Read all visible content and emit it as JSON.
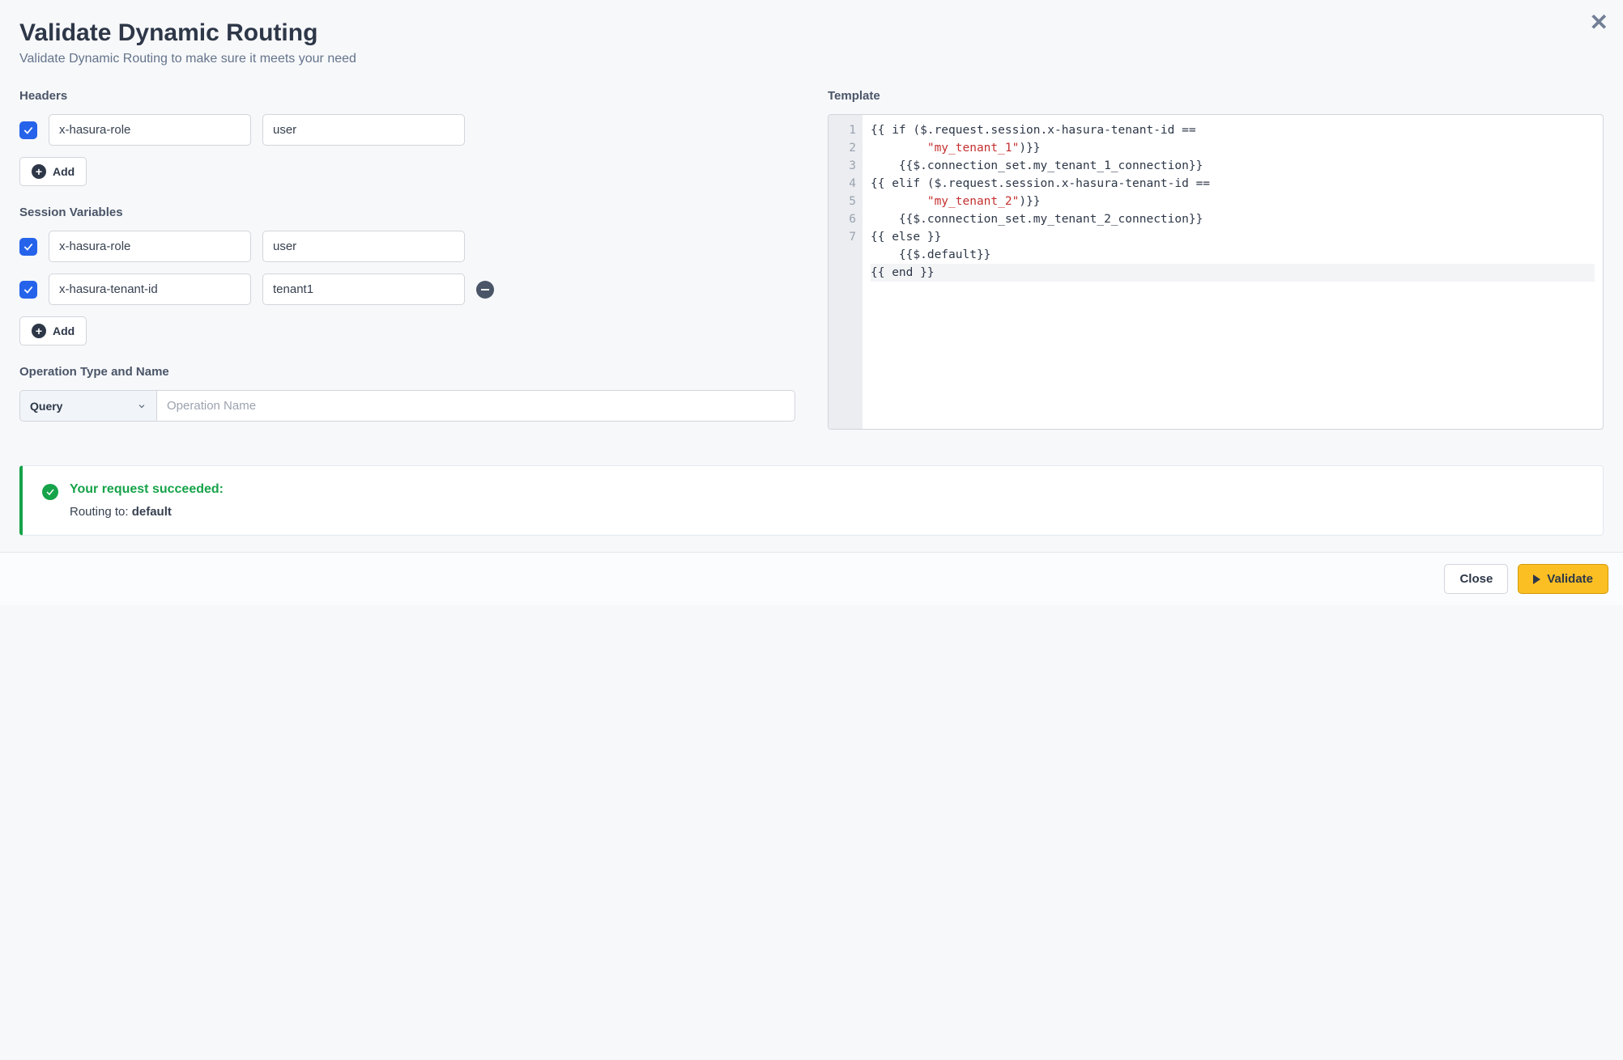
{
  "modal": {
    "title": "Validate Dynamic Routing",
    "subtitle": "Validate Dynamic Routing to make sure it meets your need"
  },
  "sections": {
    "headers_label": "Headers",
    "session_vars_label": "Session Variables",
    "operation_label": "Operation Type and Name",
    "template_label": "Template"
  },
  "headers": [
    {
      "key": "x-hasura-role",
      "value": "user",
      "checked": true
    }
  ],
  "session_vars": [
    {
      "key": "x-hasura-role",
      "value": "user",
      "checked": true,
      "removable": false
    },
    {
      "key": "x-hasura-tenant-id",
      "value": "tenant1",
      "checked": true,
      "removable": true
    }
  ],
  "add_button_label": "Add",
  "operation": {
    "type": "Query",
    "name_placeholder": "Operation Name",
    "name_value": ""
  },
  "template": {
    "lines": [
      {
        "n": 1,
        "pre": "{{ if ($.request.session.x-hasura-tenant-id ==\n        ",
        "str": "\"my_tenant_1\"",
        "post": ")}}"
      },
      {
        "n": 2,
        "text": "    {{$.connection_set.my_tenant_1_connection}}"
      },
      {
        "n": 3,
        "pre": "{{ elif ($.request.session.x-hasura-tenant-id ==\n        ",
        "str": "\"my_tenant_2\"",
        "post": ")}}"
      },
      {
        "n": 4,
        "text": "    {{$.connection_set.my_tenant_2_connection}}"
      },
      {
        "n": 5,
        "text": "{{ else }}"
      },
      {
        "n": 6,
        "text": "    {{$.default}}"
      },
      {
        "n": 7,
        "text": "{{ end }}",
        "active": true
      }
    ],
    "gutter": [
      "1",
      "2",
      "3",
      "4",
      "5",
      "6",
      "7"
    ]
  },
  "result": {
    "success_title": "Your request succeeded:",
    "routing_prefix": "Routing to: ",
    "routing_target": "default"
  },
  "footer": {
    "close": "Close",
    "validate": "Validate"
  }
}
